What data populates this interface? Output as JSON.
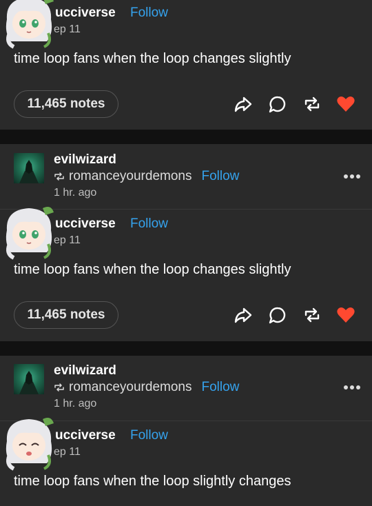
{
  "posts": [
    {
      "author": "ucciverse",
      "follow": "Follow",
      "date": "ep 11",
      "text": "time loop fans when the loop changes slightly",
      "notes": "11,465 notes"
    },
    {
      "author": "ucciverse",
      "follow": "Follow",
      "date": "ep 11",
      "text": "time loop fans when the loop changes slightly",
      "notes": "11,465 notes"
    },
    {
      "author": "ucciverse",
      "follow": "Follow",
      "date": "ep 11",
      "text": "time loop fans when the loop slightly changes"
    }
  ],
  "reblogs": [
    {
      "name": "evilwizard",
      "via": "romanceyourdemons",
      "follow": "Follow",
      "time": "1 hr. ago"
    },
    {
      "name": "evilwizard",
      "via": "romanceyourdemons",
      "follow": "Follow",
      "time": "1 hr. ago"
    }
  ],
  "colors": {
    "follow": "#35a3ee",
    "like": "#ff4930",
    "panel": "#2a2a2a",
    "gap": "#111111"
  },
  "icons": [
    "share-icon",
    "reply-icon",
    "reblog-icon",
    "heart-icon",
    "more-icon",
    "reblog-small-icon"
  ]
}
